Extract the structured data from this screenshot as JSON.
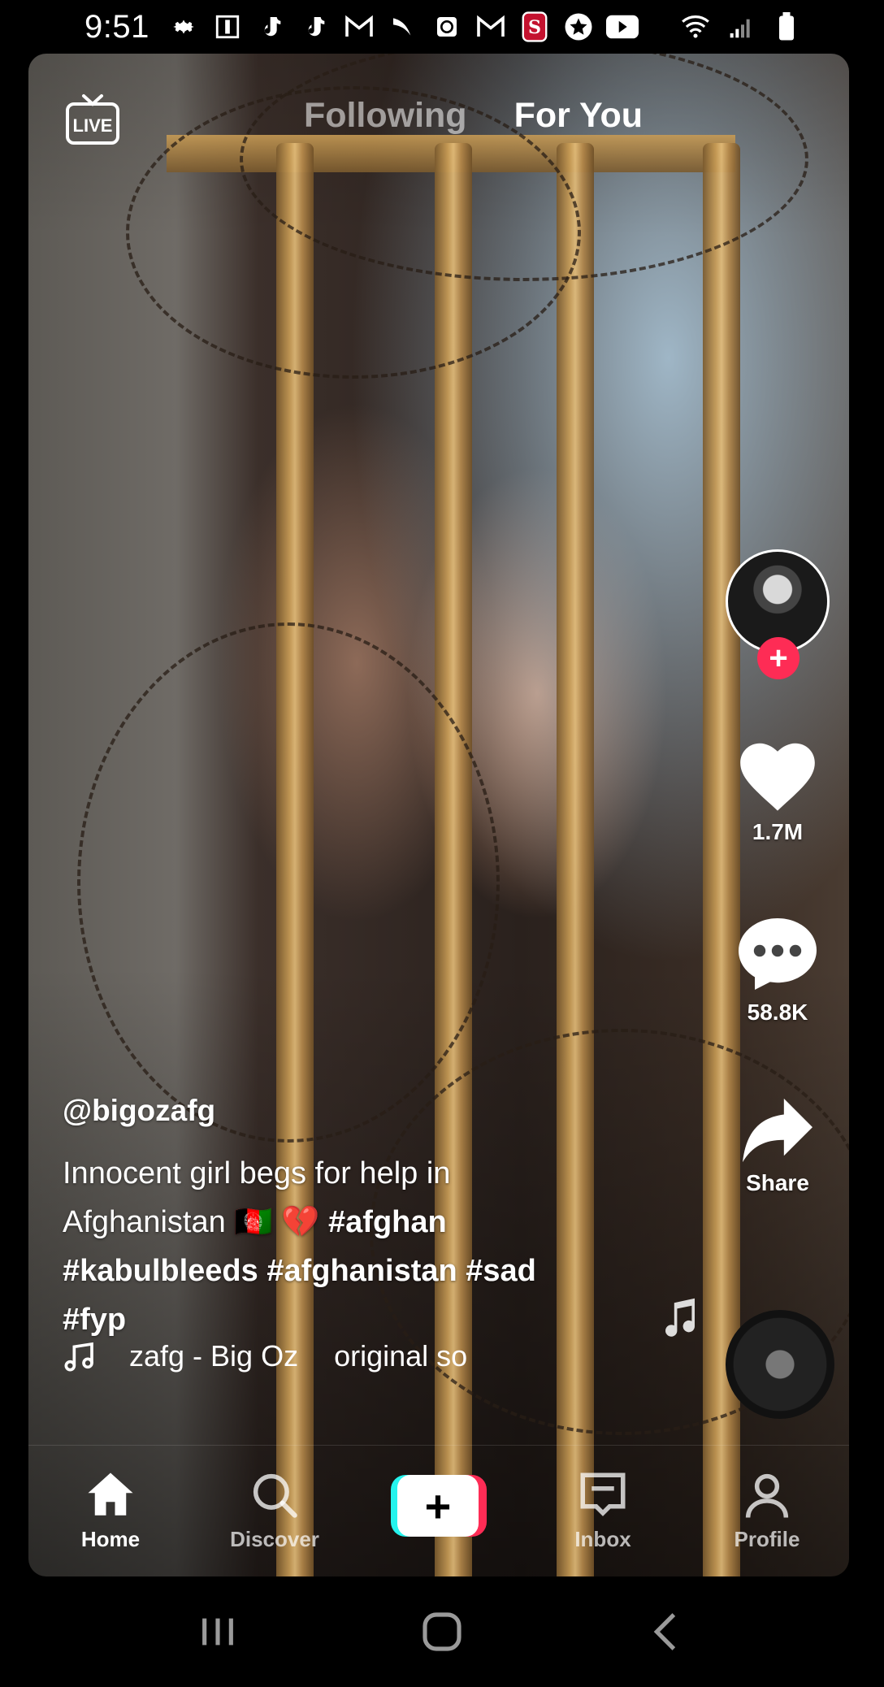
{
  "status_bar": {
    "time": "9:51",
    "icons": [
      "gear-icon",
      "badge-icon",
      "tiktok-icon",
      "tiktok-icon",
      "gmail-icon",
      "sprint-icon",
      "clock-icon",
      "gmail-icon",
      "stanford-icon",
      "star-icon",
      "youtube-icon"
    ],
    "right_icons": [
      "wifi-icon",
      "signal-icon",
      "battery-icon"
    ]
  },
  "top": {
    "live_label": "LIVE",
    "tab_following": "Following",
    "tab_for_you": "For You"
  },
  "rail": {
    "likes": "1.7M",
    "comments": "58.8K",
    "share_label": "Share",
    "follow_plus": "+"
  },
  "caption": {
    "username": "@bigozafg",
    "text_line1": "Innocent girl begs for help in",
    "text_line2_plain": "Afghanistan 🇦🇫 💔 ",
    "tag_afghan": "#afghan",
    "tag_kabul": "#kabulbleeds",
    "tag_afghanistan": "#afghanistan",
    "tag_sad": "#sad",
    "tag_fyp": "#fyp",
    "music_part1": "zafg - Big Oz",
    "music_part2": "original so"
  },
  "nav": {
    "home": "Home",
    "discover": "Discover",
    "create": "+",
    "inbox": "Inbox",
    "profile": "Profile"
  },
  "colors": {
    "accent_red": "#fe2c55",
    "accent_cyan": "#25f4ee"
  }
}
